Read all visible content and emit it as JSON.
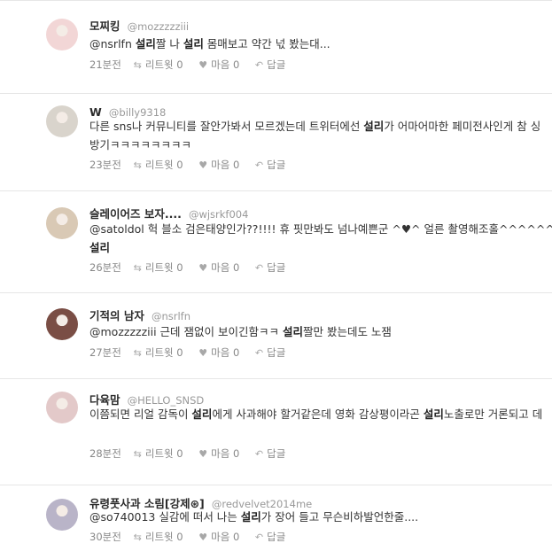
{
  "tweets": [
    {
      "name": "모찌킹",
      "handle": "@mozzzzziii",
      "text": [
        {
          "t": "@nsrlfn ",
          "s": "mention"
        },
        {
          "t": "설리",
          "s": "hl"
        },
        {
          "t": "짤 나 ",
          "s": ""
        },
        {
          "t": "설리",
          "s": "hl"
        },
        {
          "t": " 몸매보고 약간 넋 봤는대...",
          "s": ""
        }
      ],
      "time": "21분전",
      "retweet": "리트윗 0",
      "like": "마음 0",
      "reply": "답글",
      "avatar_color": "#f2d6d6"
    },
    {
      "name": "W",
      "handle": "@billy9318",
      "text": [
        {
          "t": "다른 sns나 커뮤니티를 잘안가봐서 모르겠는데 트위터에선 ",
          "s": ""
        },
        {
          "t": "설리",
          "s": "hl"
        },
        {
          "t": "가 어마어마한 페미전사인게 참 싱 방기ㅋㅋㅋㅋㅋㅋㅋㅋ",
          "s": ""
        }
      ],
      "time": "23분전",
      "retweet": "리트윗 0",
      "like": "마음 0",
      "reply": "답글",
      "avatar_color": "#d9d4cc"
    },
    {
      "name": "슬레이어즈 보자....",
      "handle": "@wjsrkf004",
      "text": [
        {
          "t": "@satoldol 헉 블소 검은태양인가??!!!! 휴 핏만봐도 넘나예쁜군 ^♥^ 얼른 촬영해조홀^^^^^^ ",
          "s": "mention"
        },
        {
          "t": "설리",
          "s": "hl"
        }
      ],
      "time": "26분전",
      "retweet": "리트윗 0",
      "like": "마음 0",
      "reply": "답글",
      "avatar_color": "#d9c9b5"
    },
    {
      "name": "기적의 남자",
      "handle": "@nsrlfn",
      "text": [
        {
          "t": "@mozzzzziii 근데 잼없이 보이긴함ㅋㅋ ",
          "s": "mention"
        },
        {
          "t": "설리",
          "s": "hl"
        },
        {
          "t": "짤만 봤는데도 노잼",
          "s": ""
        }
      ],
      "time": "27분전",
      "retweet": "리트윗 0",
      "like": "마음 0",
      "reply": "답글",
      "avatar_color": "#7a4e45"
    },
    {
      "name": "다육맘",
      "handle": "@HELLO_SNSD",
      "text": [
        {
          "t": "이쯤되면 리얼 감독이 ",
          "s": ""
        },
        {
          "t": "설리",
          "s": "hl"
        },
        {
          "t": "에게 사과해야 할거같은데 영화 감상평이라곤 ",
          "s": ""
        },
        {
          "t": "설리",
          "s": "hl"
        },
        {
          "t": "노출로만 거론되고 데",
          "s": ""
        }
      ],
      "time": "28분전",
      "retweet": "리트윗 0",
      "like": "마음 0",
      "reply": "답글",
      "avatar_color": "#e3c9c9"
    },
    {
      "name": "유령풋사과 소림[강제⊛]",
      "handle": "@redvelvet2014me",
      "text": [
        {
          "t": "@so740013 실감에 떠서 나는 ",
          "s": "mention"
        },
        {
          "t": "설리",
          "s": "hl"
        },
        {
          "t": "가 장어 들고 무슨비하발언한줄....",
          "s": ""
        }
      ],
      "time": "30분전",
      "retweet": "리트윗 0",
      "like": "마음 0",
      "reply": "답글",
      "avatar_color": "#b9b4c8"
    }
  ]
}
